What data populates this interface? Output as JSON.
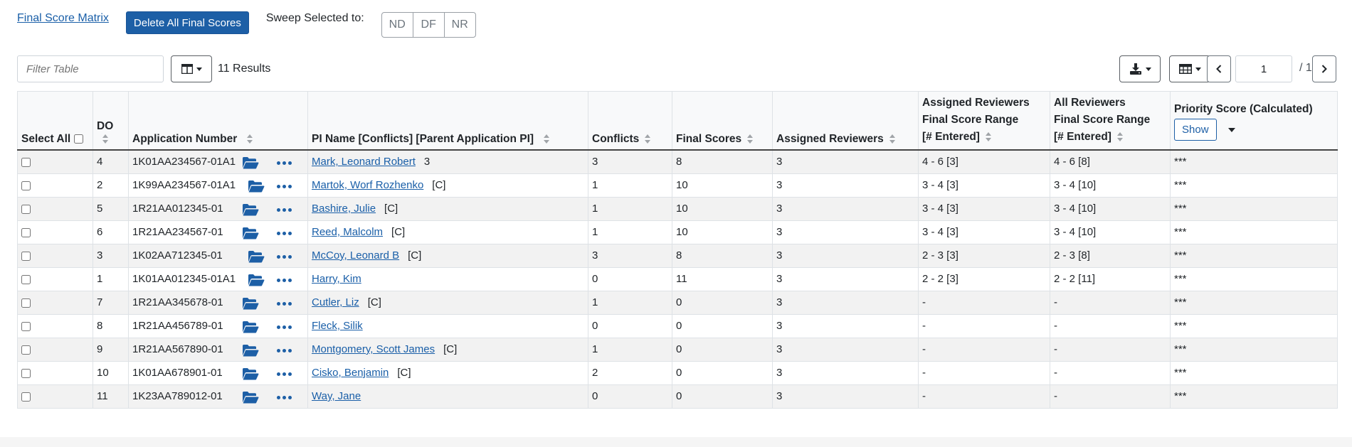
{
  "toolbar": {
    "matrix_link": "Final Score Matrix",
    "delete_button": "Delete All Final Scores",
    "sweep_label": "Sweep Selected to:",
    "sweep_options": [
      "ND",
      "DF",
      "NR"
    ]
  },
  "filter": {
    "placeholder": "Filter Table",
    "results_text": "11 Results"
  },
  "pagination": {
    "current_page": "1",
    "total_text": "/ 1"
  },
  "icons": {
    "columns": "columns-icon",
    "download": "download-icon",
    "layout": "table-layout-icon",
    "prev": "chevron-left-icon",
    "next": "chevron-right-icon",
    "folder": "folder-open-icon",
    "more": "ellipsis-icon"
  },
  "colors": {
    "primary": "#1d5fa6",
    "link": "#1a5fa8"
  },
  "table": {
    "headers": {
      "select_all": "Select All",
      "do": "DO",
      "app_number": "Application Number",
      "pi_name": "PI Name [Conflicts] [Parent Application PI]",
      "conflicts": "Conflicts",
      "final_scores": "Final Scores",
      "assigned_reviewers": "Assigned Reviewers",
      "assigned_range_1": "Assigned Reviewers",
      "assigned_range_2": "Final Score Range",
      "assigned_range_3": "[# Entered]",
      "all_range_1": "All Reviewers",
      "all_range_2": "Final Score Range",
      "all_range_3": "[# Entered]",
      "priority": "Priority Score (Calculated)",
      "show_button": "Show"
    },
    "rows": [
      {
        "do": "4",
        "app": "1K01AA234567-01A1",
        "pi": "Mark, Leonard Robert",
        "flag": "3",
        "conflicts": "3",
        "final": "8",
        "assigned": "3",
        "arange": "4 - 6 [3]",
        "allrange": "4 - 6 [8]",
        "priority": "***"
      },
      {
        "do": "2",
        "app": "1K99AA234567-01A1",
        "pi": "Martok, Worf Rozhenko",
        "flag": "[C]",
        "conflicts": "1",
        "final": "10",
        "assigned": "3",
        "arange": "3 - 4 [3]",
        "allrange": "3 - 4 [10]",
        "priority": "***"
      },
      {
        "do": "5",
        "app": "1R21AA012345-01",
        "pi": "Bashire, Julie",
        "flag": "[C]",
        "conflicts": "1",
        "final": "10",
        "assigned": "3",
        "arange": "3 - 4 [3]",
        "allrange": "3 - 4 [10]",
        "priority": "***"
      },
      {
        "do": "6",
        "app": "1R21AA234567-01",
        "pi": "Reed, Malcolm",
        "flag": "[C]",
        "conflicts": "1",
        "final": "10",
        "assigned": "3",
        "arange": "3 - 4 [3]",
        "allrange": "3 - 4 [10]",
        "priority": "***"
      },
      {
        "do": "3",
        "app": "1K02AA712345-01",
        "pi": "McCoy, Leonard B",
        "flag": "[C]",
        "conflicts": "3",
        "final": "8",
        "assigned": "3",
        "arange": "2 - 3 [3]",
        "allrange": "2 - 3 [8]",
        "priority": "***"
      },
      {
        "do": "1",
        "app": "1K01AA012345-01A1",
        "pi": "Harry, Kim",
        "flag": "",
        "conflicts": "0",
        "final": "11",
        "assigned": "3",
        "arange": "2 - 2 [3]",
        "allrange": "2 - 2 [11]",
        "priority": "***"
      },
      {
        "do": "7",
        "app": "1R21AA345678-01",
        "pi": "Cutler, Liz",
        "flag": "[C]",
        "conflicts": "1",
        "final": "0",
        "assigned": "3",
        "arange": "-",
        "allrange": "-",
        "priority": "***"
      },
      {
        "do": "8",
        "app": "1R21AA456789-01",
        "pi": "Fleck, Silik",
        "flag": "",
        "conflicts": "0",
        "final": "0",
        "assigned": "3",
        "arange": "-",
        "allrange": "-",
        "priority": "***"
      },
      {
        "do": "9",
        "app": "1R21AA567890-01",
        "pi": "Montgomery, Scott James",
        "flag": "[C]",
        "conflicts": "1",
        "final": "0",
        "assigned": "3",
        "arange": "-",
        "allrange": "-",
        "priority": "***"
      },
      {
        "do": "10",
        "app": "1K01AA678901-01",
        "pi": "Cisko, Benjamin",
        "flag": "[C]",
        "conflicts": "2",
        "final": "0",
        "assigned": "3",
        "arange": "-",
        "allrange": "-",
        "priority": "***"
      },
      {
        "do": "11",
        "app": "1K23AA789012-01",
        "pi": "Way, Jane",
        "flag": "",
        "conflicts": "0",
        "final": "0",
        "assigned": "3",
        "arange": "-",
        "allrange": "-",
        "priority": "***"
      }
    ]
  }
}
